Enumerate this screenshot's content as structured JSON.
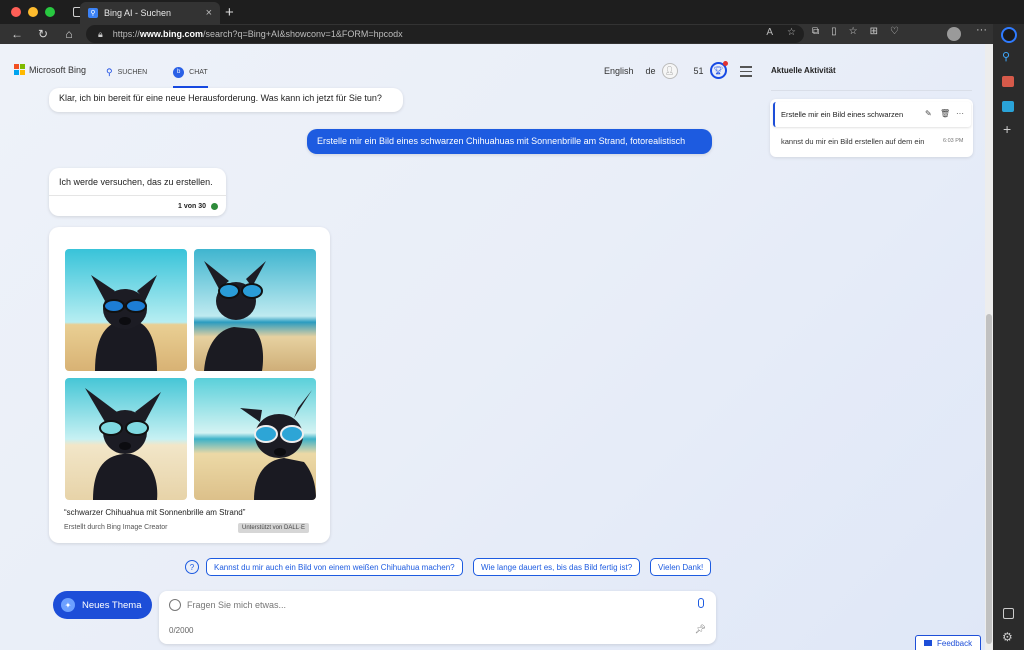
{
  "browser": {
    "tab_title": "Bing AI - Suchen",
    "url_prefix": "https://",
    "url_domain": "www.bing.com",
    "url_path": "/search?q=Bing+AI&showconv=1&FORM=hpcodx"
  },
  "header": {
    "logo_text": "Microsoft Bing",
    "nav_search": "SUCHEN",
    "nav_chat": "CHAT",
    "language": "English",
    "locale": "de",
    "points": "51"
  },
  "chat": {
    "msg_bot_1": "Klar, ich bin bereit für eine neue Herausforderung. Was kann ich jetzt für Sie tun?",
    "msg_user_1": "Erstelle mir ein Bild eines schwarzen Chihuahuas mit Sonnenbrille am Strand, fotorealistisch",
    "msg_bot_2": "Ich werde versuchen, das zu erstellen.",
    "turn_counter": "1 von 30",
    "image_caption": "“schwarzer Chihuahua mit Sonnenbrille am Strand”",
    "image_credit": "Erstellt durch Bing Image Creator",
    "image_badge": "Unterstützt von DALL·E"
  },
  "suggestions": [
    "Kannst du mir auch ein Bild von einem weißen Chihuahua machen?",
    "Wie lange dauert es, bis das Bild fertig ist?",
    "Vielen Dank!"
  ],
  "composer": {
    "new_topic": "Neues Thema",
    "placeholder": "Fragen Sie mich etwas...",
    "char_count": "0/2000"
  },
  "activity": {
    "title": "Aktuelle Aktivität",
    "items": [
      {
        "text": "Erstelle mir ein Bild eines schwarzen",
        "time": ""
      },
      {
        "text": "kannst du mir ein Bild erstellen auf dem ein",
        "time": "6:03 PM"
      }
    ]
  },
  "feedback_label": "Feedback",
  "colors": {
    "accent": "#1d5be0",
    "page_bg": "#e9eef8"
  }
}
